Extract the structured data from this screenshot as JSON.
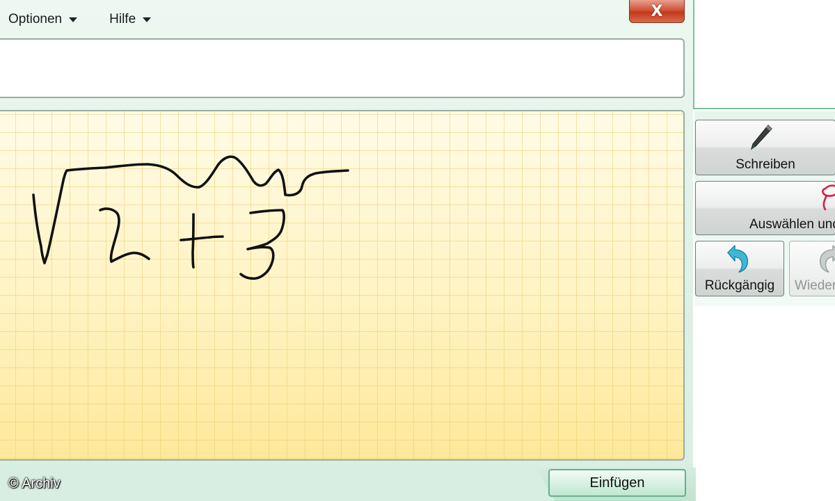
{
  "menu": {
    "options_label": "Optionen",
    "help_label": "Hilfe"
  },
  "close_button": {
    "label": "X",
    "color": "#c33a1f"
  },
  "preview": {
    "value": ""
  },
  "toolbar": {
    "write_label": "Schreiben",
    "select_label": "Auswählen und",
    "undo_label": "Rückgängig",
    "redo_label": "Wiederholen"
  },
  "insert_button": {
    "label": "Einfügen"
  },
  "watermark": {
    "text": "© Archiv"
  },
  "colors": {
    "accent": "#5fb38a",
    "writing_pad": "#fff3c2",
    "grid": "#eace6e",
    "ink": "#111111",
    "undo_icon": "#27a6c8",
    "select_icon": "#d6203f"
  },
  "icons": {
    "write": "pen-icon",
    "select": "lasso-icon",
    "undo": "undo-arrow-icon",
    "redo": "redo-arrow-icon",
    "close": "close-icon",
    "menu_arrow": "chevron-down-icon"
  }
}
